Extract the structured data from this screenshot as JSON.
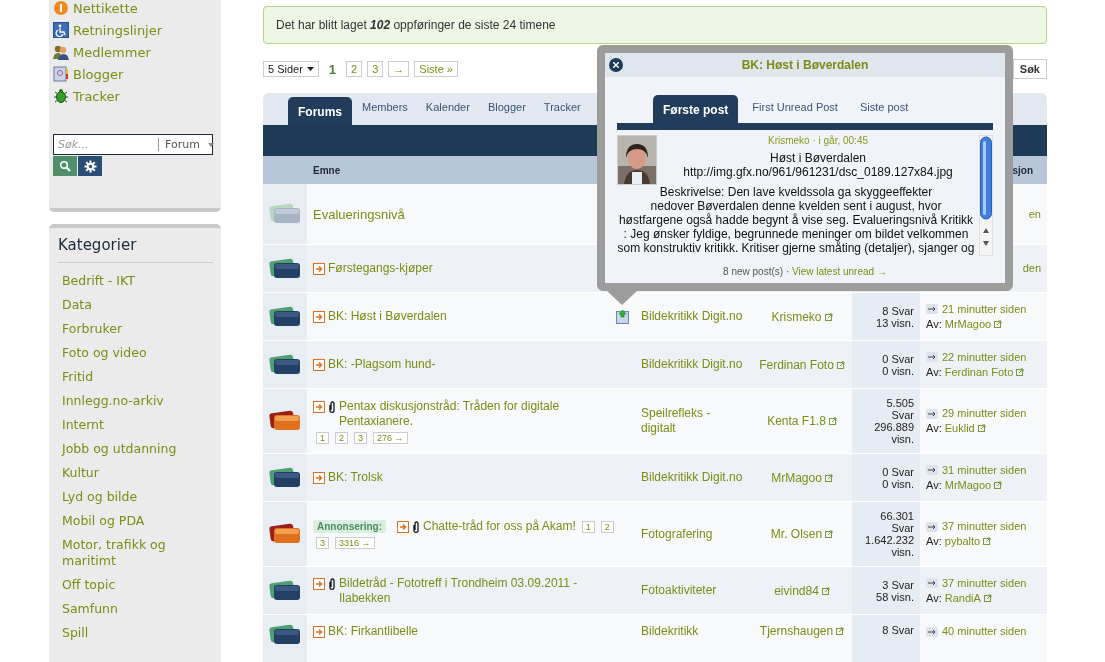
{
  "sidebar": {
    "links": [
      {
        "label": "Nettikette"
      },
      {
        "label": "Retningslinjer"
      },
      {
        "label": "Medlemmer"
      },
      {
        "label": "Blogger"
      },
      {
        "label": "Tracker"
      }
    ],
    "search": {
      "placeholder": "Søk...",
      "scope": "Forum"
    },
    "categories": {
      "title": "Kategorier",
      "items": [
        "Bedrift - IKT",
        "Data",
        "Forbruker",
        "Foto og video",
        "Fritid",
        "Innlegg.no-arkiv",
        "Internt",
        "Jobb og utdanning",
        "Kultur",
        "Lyd og bilde",
        "Mobil og PDA",
        "Motor, trafikk og maritimt",
        "Off topic",
        "Samfunn",
        "Spill"
      ]
    }
  },
  "notice": "Det har blitt laget **102** oppføringer de siste 24 timene",
  "pagination": {
    "pages_dropdown": "5 Sider",
    "pages": [
      {
        "label": "1",
        "selected": true
      },
      {
        "label": "2",
        "selected": false
      },
      {
        "label": "3",
        "selected": false
      }
    ],
    "next": "→",
    "last": "Siste »"
  },
  "search_button": "Søk",
  "tabs": [
    {
      "label": "Forums",
      "selected": true
    },
    {
      "label": "Members",
      "selected": false
    },
    {
      "label": "Kalender",
      "selected": false
    },
    {
      "label": "Blogger",
      "selected": false
    },
    {
      "label": "Tracker",
      "selected": false
    }
  ],
  "table": {
    "columns": {
      "topic": "Emne",
      "column_5": "sjon"
    },
    "rows": [
      {
        "kind": "faded",
        "unread": false,
        "title": "Evalueringsnivå",
        "last_fragment": "en"
      },
      {
        "kind": "normal",
        "unread": true,
        "title": "Førstegangs-kjøper",
        "last_fragment": "den"
      },
      {
        "kind": "normal",
        "unread": true,
        "preview": true,
        "title": "BK: Høst i Bøverdalen",
        "forum": "Bildekritikk Digit.no",
        "starter": "Krismeko",
        "replies": "8 Svar",
        "views": "13 visn.",
        "last_time": "21 minutter siden",
        "by_label": "Av:",
        "last_by": "MrMagoo"
      },
      {
        "kind": "normal",
        "unread": true,
        "title": "BK: -Plagsom hund-",
        "forum": "Bildekritikk Digit.no",
        "starter": "Ferdinan Foto",
        "replies": "0 Svar",
        "views": "0 visn.",
        "last_time": "22 minutter siden",
        "by_label": "Av:",
        "last_by": "Ferdinan Foto"
      },
      {
        "kind": "hot",
        "unread": true,
        "attachment": true,
        "title": "Pentax diskusjonstråd: Tråden for digitale Pentaxianere.",
        "pages": [
          "1",
          "2",
          "3",
          "276 →"
        ],
        "forum": "Speilrefleks - digitalt",
        "starter": "Kenta F1.8",
        "replies": "5.505 Svar",
        "views": "296.889 visn.",
        "last_time": "29 minutter siden",
        "by_label": "Av:",
        "last_by": "Euklid"
      },
      {
        "kind": "normal",
        "unread": true,
        "title": "BK: Trolsk",
        "forum": "Bildekritikk Digit.no",
        "starter": "MrMagoo",
        "replies": "0 Svar",
        "views": "0 visn.",
        "last_time": "31 minutter siden",
        "by_label": "Av:",
        "last_by": "MrMagoo"
      },
      {
        "kind": "hot",
        "prefix": "Annonsering:",
        "unread": true,
        "attachment": true,
        "title": "Chatte-tråd for oss på Akam!",
        "pages": [
          "1",
          "2",
          "3",
          "3316 →"
        ],
        "forum": "Fotografering",
        "starter": "Mr. Olsen",
        "replies": "66.301 Svar",
        "views": "1.642.232 visn.",
        "last_time": "37 minutter siden",
        "by_label": "Av:",
        "last_by": "pybalto"
      },
      {
        "kind": "normal",
        "unread": true,
        "attachment": true,
        "title": "Bildetråd - Fototreff i Trondheim 03.09.2011 - Ilabekken",
        "forum": "Fotoaktiviteter",
        "starter": "eivind84",
        "replies": "3 Svar",
        "views": "58 visn.",
        "last_time": "37 minutter siden",
        "by_label": "Av:",
        "last_by": "RandiA"
      },
      {
        "kind": "normal",
        "unread": true,
        "title": "BK: Firkantlibelle",
        "forum": "Bildekritikk",
        "starter": "Tjernshaugen",
        "replies": "8 Svar",
        "last_time": "40 minutter siden"
      }
    ]
  },
  "preview_popup": {
    "title": "BK: Høst i Bøverdalen",
    "tabs": [
      {
        "label": "Første post",
        "selected": true
      },
      {
        "label": "First Unread Post",
        "selected": false
      },
      {
        "label": "Siste post",
        "selected": false
      }
    ],
    "meta": "Krismeko · i går, 00:45",
    "body_lines": [
      "Høst i Bøverdalen",
      "http://img.gfx.no/961/961231/dsc_0189.127x84.jpg",
      "Beskrivelse: Den lave kveldssola ga skyggeeffekter",
      "nedover Bøverdalen denne kvelden sent i august, hvor",
      "høstfargene også hadde begynt å vise seg. Evalueringsnivå Kritikk",
      ": Jeg ønsker fyldige, begrunnede meninger om bildet velkommen",
      "som konstruktiv kritikk. Kritiser gjerne småting (detaljer), sjanger og"
    ],
    "footer_count": "8 new post(s) ·",
    "footer_link": "View latest unread →"
  }
}
